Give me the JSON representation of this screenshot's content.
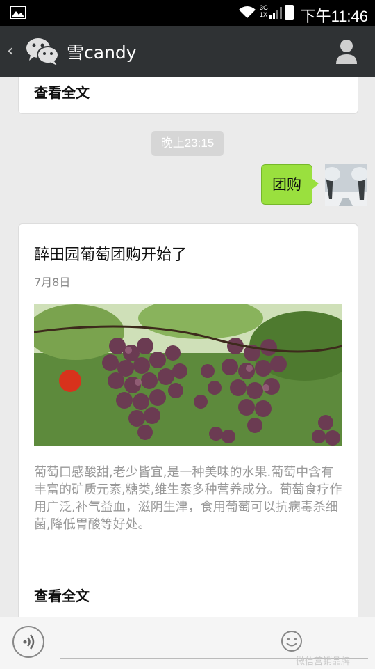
{
  "status_bar": {
    "time": "下午11:46",
    "network_top": "3G",
    "network_bottom": "1X"
  },
  "header": {
    "contact_name": "雪candy"
  },
  "top_card": {
    "read_more": "查看全文"
  },
  "timestamp": "晚上23:15",
  "sent_message": {
    "text": "团购"
  },
  "article": {
    "title": "醉田园葡萄团购开始了",
    "date": "7月8日",
    "description": "葡萄口感酸甜,老少皆宜,是一种美味的水果.葡萄中含有丰富的矿质元素,糖类,维生素多种营养成分。葡萄食疗作用广泛,补气益血，滋阴生津，食用葡萄可以抗病毒杀细菌,降低胃酸等好处。",
    "read_more": "查看全文"
  },
  "bottom_bar": {
    "watermark": "微信营销品牌"
  },
  "colors": {
    "title_bar": "#2f3234",
    "bubble": "#9ae03e",
    "background": "#ebebeb"
  }
}
